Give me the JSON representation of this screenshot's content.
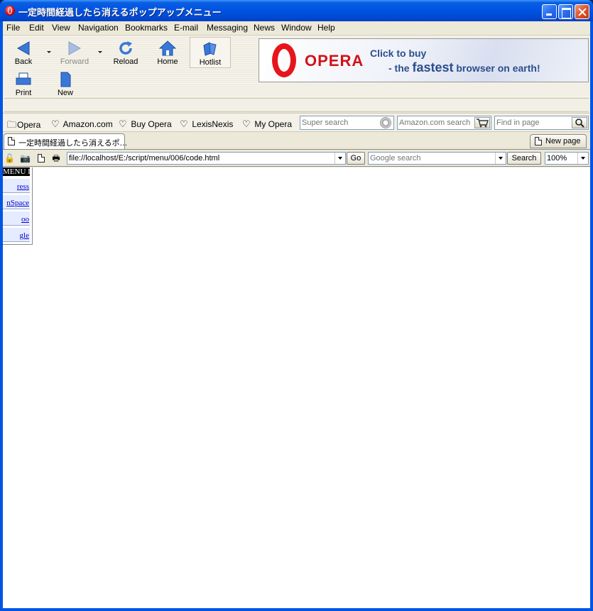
{
  "window": {
    "title": "一定時間経過したら消えるポップアップメニュー"
  },
  "menubar": {
    "items": [
      "File",
      "Edit",
      "View",
      "Navigation",
      "Bookmarks",
      "E-mail",
      "Messaging",
      "News",
      "Window",
      "Help"
    ]
  },
  "toolbar": {
    "back": "Back",
    "forward": "Forward",
    "reload": "Reload",
    "home": "Home",
    "hotlist": "Hotlist",
    "print": "Print",
    "new": "New"
  },
  "banner": {
    "brand": "OPERA",
    "line1": "Click to buy",
    "line2_prefix": "- the ",
    "line2_bold": "fastest",
    "line2_suffix": " browser on earth!"
  },
  "personal_bar": {
    "items": [
      "Opera",
      "Amazon.com",
      "Buy Opera",
      "LexisNexis",
      "My Opera"
    ],
    "super_search_placeholder": "Super search",
    "amazon_search_placeholder": "Amazon.com search",
    "find_in_page_placeholder": "Find in page"
  },
  "tabs": {
    "active_title": "一定時間経過したら消えるポ...",
    "new_page_label": "New page"
  },
  "address_bar": {
    "url": "file://localhost/E:/script/menu/006/code.html",
    "go_label": "Go",
    "google_placeholder": "Google search",
    "search_label": "Search",
    "zoom": "100%"
  },
  "page": {
    "popup_menu": {
      "header": "MENU III",
      "items": [
        "ress",
        "nSpace",
        "oo",
        "gle"
      ]
    }
  },
  "colors": {
    "titlebar": "#0054e3",
    "chrome": "#ece9d8",
    "menu_item_bg": "#e6ecff",
    "link": "#0000cc",
    "opera_red": "#d1121a"
  }
}
